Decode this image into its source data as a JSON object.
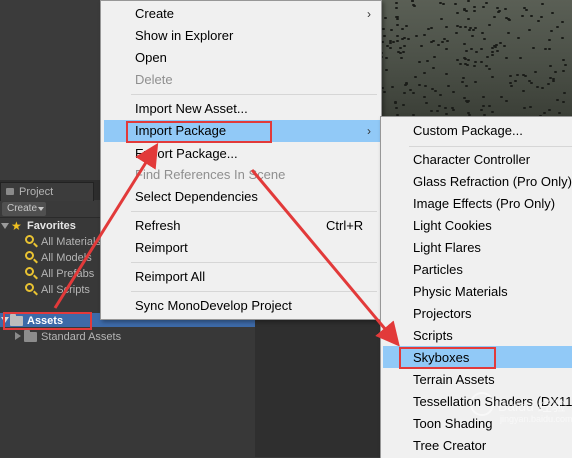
{
  "colors": {
    "menu_bg": "#f0f0f0",
    "menu_highlight": "#91c9f7",
    "annotation_red": "#e23a3a",
    "editor_dark": "#383838",
    "selection_blue": "#3d6aa8"
  },
  "project_panel": {
    "tab_label": "Project",
    "create_label": "Create",
    "favorites_label": "Favorites",
    "favorites": [
      {
        "label": "All Materials",
        "icon": "search-icon"
      },
      {
        "label": "All Models",
        "icon": "search-icon"
      },
      {
        "label": "All Prefabs",
        "icon": "search-icon"
      },
      {
        "label": "All Scripts",
        "icon": "search-icon"
      }
    ],
    "assets_label": "Assets",
    "standard_assets_label": "Standard Assets"
  },
  "context_menu": {
    "items": [
      {
        "label": "Create",
        "has_submenu": true
      },
      {
        "label": "Show in Explorer"
      },
      {
        "label": "Open"
      },
      {
        "label": "Delete",
        "disabled": true
      },
      {
        "label": "Import New Asset..."
      },
      {
        "label": "Import Package",
        "has_submenu": true,
        "highlighted": true
      },
      {
        "label": "Export Package..."
      },
      {
        "label": "Find References In Scene",
        "disabled": true
      },
      {
        "label": "Select Dependencies"
      },
      {
        "label": "Refresh",
        "shortcut": "Ctrl+R"
      },
      {
        "label": "Reimport"
      },
      {
        "label": "Reimport All"
      },
      {
        "label": "Sync MonoDevelop Project"
      }
    ]
  },
  "import_package_submenu": {
    "items": [
      {
        "label": "Custom Package..."
      },
      {
        "label": "Character Controller"
      },
      {
        "label": "Glass Refraction (Pro Only)"
      },
      {
        "label": "Image Effects (Pro Only)"
      },
      {
        "label": "Light Cookies"
      },
      {
        "label": "Light Flares"
      },
      {
        "label": "Particles"
      },
      {
        "label": "Physic Materials"
      },
      {
        "label": "Projectors"
      },
      {
        "label": "Scripts"
      },
      {
        "label": "Skyboxes",
        "highlighted": true
      },
      {
        "label": "Terrain Assets"
      },
      {
        "label": "Tessellation Shaders (DX11"
      },
      {
        "label": "Toon Shading"
      },
      {
        "label": "Tree Creator"
      }
    ]
  },
  "watermark": {
    "text": "Baidu 经验",
    "url": "jingyan.baidu.com"
  }
}
